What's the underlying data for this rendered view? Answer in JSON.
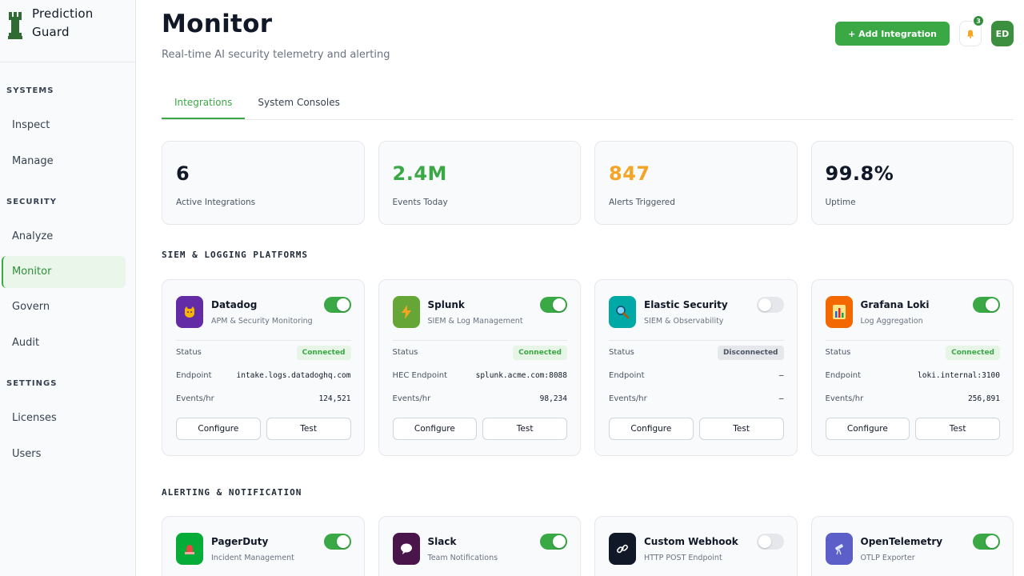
{
  "brand": {
    "name_line1": "Prediction",
    "name_line2": "Guard"
  },
  "sidebar": {
    "sections": [
      {
        "title": "SYSTEMS",
        "items": [
          {
            "label": "Inspect"
          },
          {
            "label": "Manage"
          }
        ]
      },
      {
        "title": "SECURITY",
        "items": [
          {
            "label": "Analyze"
          },
          {
            "label": "Monitor",
            "active": true
          },
          {
            "label": "Govern"
          },
          {
            "label": "Audit"
          }
        ]
      },
      {
        "title": "SETTINGS",
        "items": [
          {
            "label": "Licenses"
          },
          {
            "label": "Users"
          }
        ]
      }
    ]
  },
  "header": {
    "title": "Monitor",
    "subtitle": "Real-time AI security telemetry and alerting",
    "add_button": "+ Add Integration",
    "notification_count": "3",
    "avatar_initials": "ED"
  },
  "tabs": [
    {
      "label": "Integrations",
      "active": true
    },
    {
      "label": "System Consoles"
    }
  ],
  "stats": [
    {
      "value": "6",
      "label": "Active Integrations",
      "color": "#111827"
    },
    {
      "value": "2.4M",
      "label": "Events Today",
      "color": "#3aa845"
    },
    {
      "value": "847",
      "label": "Alerts Triggered",
      "color": "#f5a524"
    },
    {
      "value": "99.8%",
      "label": "Uptime",
      "color": "#111827"
    }
  ],
  "sections": {
    "siem": "SIEM & LOGGING PLATFORMS",
    "alerting": "ALERTING & NOTIFICATION"
  },
  "siem_cards": [
    {
      "name": "Datadog",
      "desc": "APM & Security Monitoring",
      "enabled": true,
      "icon": "dog-icon",
      "icon_bg": "#632ca6",
      "status_label": "Status",
      "status": "Connected",
      "endpoint_label": "Endpoint",
      "endpoint": "intake.logs.datadoghq.com",
      "events_label": "Events/hr",
      "events": "124,521",
      "configure": "Configure",
      "test": "Test"
    },
    {
      "name": "Splunk",
      "desc": "SIEM & Log Management",
      "enabled": true,
      "icon": "lightning-icon",
      "icon_bg": "#65a637",
      "status_label": "Status",
      "status": "Connected",
      "endpoint_label": "HEC Endpoint",
      "endpoint": "splunk.acme.com:8088",
      "events_label": "Events/hr",
      "events": "98,234",
      "configure": "Configure",
      "test": "Test"
    },
    {
      "name": "Elastic Security",
      "desc": "SIEM & Observability",
      "enabled": false,
      "icon": "magnifier-icon",
      "icon_bg": "#00a9a5",
      "status_label": "Status",
      "status": "Disconnected",
      "endpoint_label": "Endpoint",
      "endpoint": "—",
      "events_label": "Events/hr",
      "events": "—",
      "configure": "Configure",
      "test": "Test"
    },
    {
      "name": "Grafana Loki",
      "desc": "Log Aggregation",
      "enabled": true,
      "icon": "bar-chart-icon",
      "icon_bg": "#f46800",
      "status_label": "Status",
      "status": "Connected",
      "endpoint_label": "Endpoint",
      "endpoint": "loki.internal:3100",
      "events_label": "Events/hr",
      "events": "256,891",
      "configure": "Configure",
      "test": "Test"
    }
  ],
  "alert_cards": [
    {
      "name": "PagerDuty",
      "desc": "Incident Management",
      "enabled": true,
      "icon": "siren-icon",
      "icon_bg": "#06ac38"
    },
    {
      "name": "Slack",
      "desc": "Team Notifications",
      "enabled": true,
      "icon": "chat-bubble-icon",
      "icon_bg": "#4a154b"
    },
    {
      "name": "Custom Webhook",
      "desc": "HTTP POST Endpoint",
      "enabled": false,
      "icon": "link-icon",
      "icon_bg": "#111827"
    },
    {
      "name": "OpenTelemetry",
      "desc": "OTLP Exporter",
      "enabled": true,
      "icon": "telescope-icon",
      "icon_bg": "#5b5fc7"
    }
  ]
}
